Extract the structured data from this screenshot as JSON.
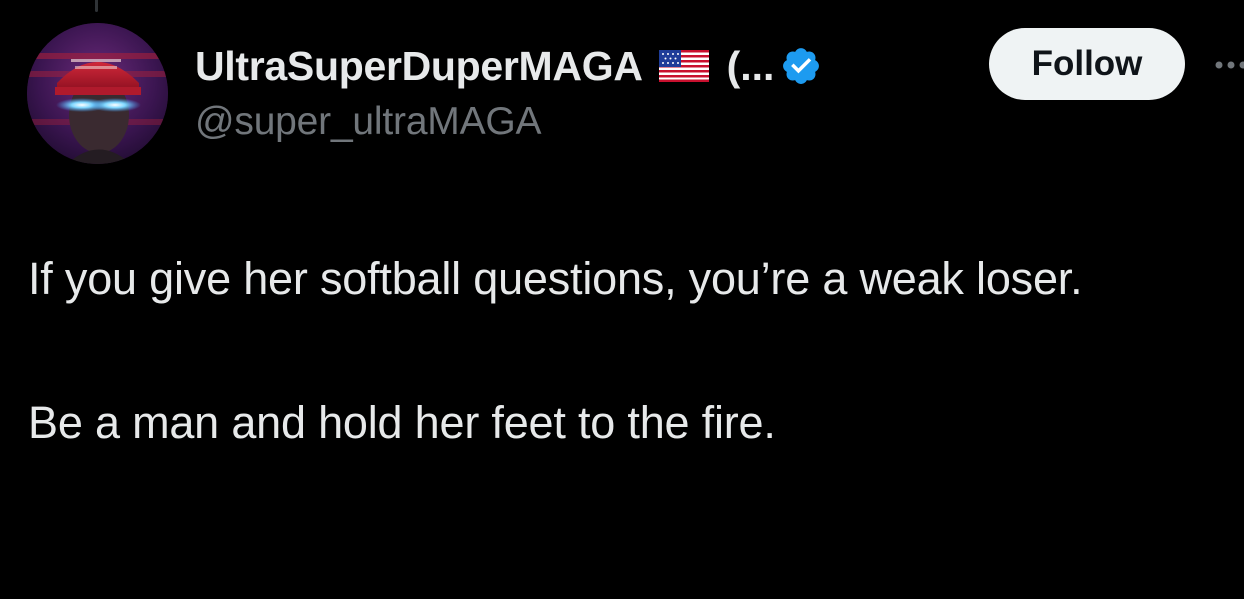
{
  "author": {
    "display_name": "UltraSuperDuperMAGA",
    "flag_icon": "us-flag-icon",
    "name_overflow": "(...",
    "verified_icon": "verified-badge-icon",
    "verified_color": "#1d9bf0",
    "handle": "@super_ultraMAGA"
  },
  "follow_button": {
    "label": "Follow"
  },
  "more_icon": "more-options-icon",
  "tweet": {
    "paragraphs": [
      "If you give her softball questions, you’re a weak loser.",
      "Be a man and hold her feet to the fire."
    ]
  },
  "colors": {
    "background": "#000000",
    "text_primary": "#e7e9ea",
    "text_secondary": "#71767b",
    "button_bg": "#eff3f4",
    "button_text": "#0f1419"
  }
}
